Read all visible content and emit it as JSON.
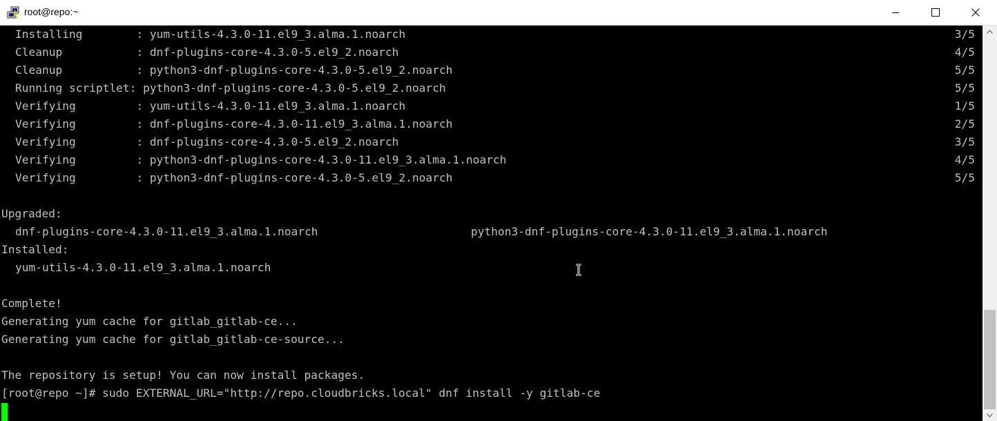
{
  "window": {
    "title": "root@repo:~",
    "icons": {
      "app": "putty-icon",
      "minimize": "minimize-icon",
      "maximize": "maximize-icon",
      "close": "close-icon"
    }
  },
  "terminal": {
    "transaction_lines": [
      {
        "action": "Installing        ",
        "package": ": yum-utils-4.3.0-11.el9_3.alma.1.noarch",
        "progress": "3/5"
      },
      {
        "action": "Cleanup           ",
        "package": ": dnf-plugins-core-4.3.0-5.el9_2.noarch",
        "progress": "4/5"
      },
      {
        "action": "Cleanup           ",
        "package": ": python3-dnf-plugins-core-4.3.0-5.el9_2.noarch",
        "progress": "5/5"
      },
      {
        "action": "Running scriptlet",
        "package": ": python3-dnf-plugins-core-4.3.0-5.el9_2.noarch",
        "progress": "5/5"
      },
      {
        "action": "Verifying         ",
        "package": ": yum-utils-4.3.0-11.el9_3.alma.1.noarch",
        "progress": "1/5"
      },
      {
        "action": "Verifying         ",
        "package": ": dnf-plugins-core-4.3.0-11.el9_3.alma.1.noarch",
        "progress": "2/5"
      },
      {
        "action": "Verifying         ",
        "package": ": dnf-plugins-core-4.3.0-5.el9_2.noarch",
        "progress": "3/5"
      },
      {
        "action": "Verifying         ",
        "package": ": python3-dnf-plugins-core-4.3.0-11.el9_3.alma.1.noarch",
        "progress": "4/5"
      },
      {
        "action": "Verifying         ",
        "package": ": python3-dnf-plugins-core-4.3.0-5.el9_2.noarch",
        "progress": "5/5"
      }
    ],
    "upgraded_label": "Upgraded:",
    "upgraded_packages": [
      "dnf-plugins-core-4.3.0-11.el9_3.alma.1.noarch",
      "python3-dnf-plugins-core-4.3.0-11.el9_3.alma.1.noarch"
    ],
    "installed_label": "Installed:",
    "installed_packages": [
      "yum-utils-4.3.0-11.el9_3.alma.1.noarch"
    ],
    "complete": "Complete!",
    "cache_lines": [
      "Generating yum cache for gitlab_gitlab-ce...",
      "Generating yum cache for gitlab_gitlab-ce-source..."
    ],
    "setup_message": "The repository is setup! You can now install packages.",
    "prompt_command": "[root@repo ~]# sudo EXTERNAL_URL=\"http://repo.cloudbricks.local\" dnf install -y gitlab-ce",
    "cursor_color": "#00ff00",
    "text_color": "#c0c0c0",
    "background_color": "#000000"
  }
}
